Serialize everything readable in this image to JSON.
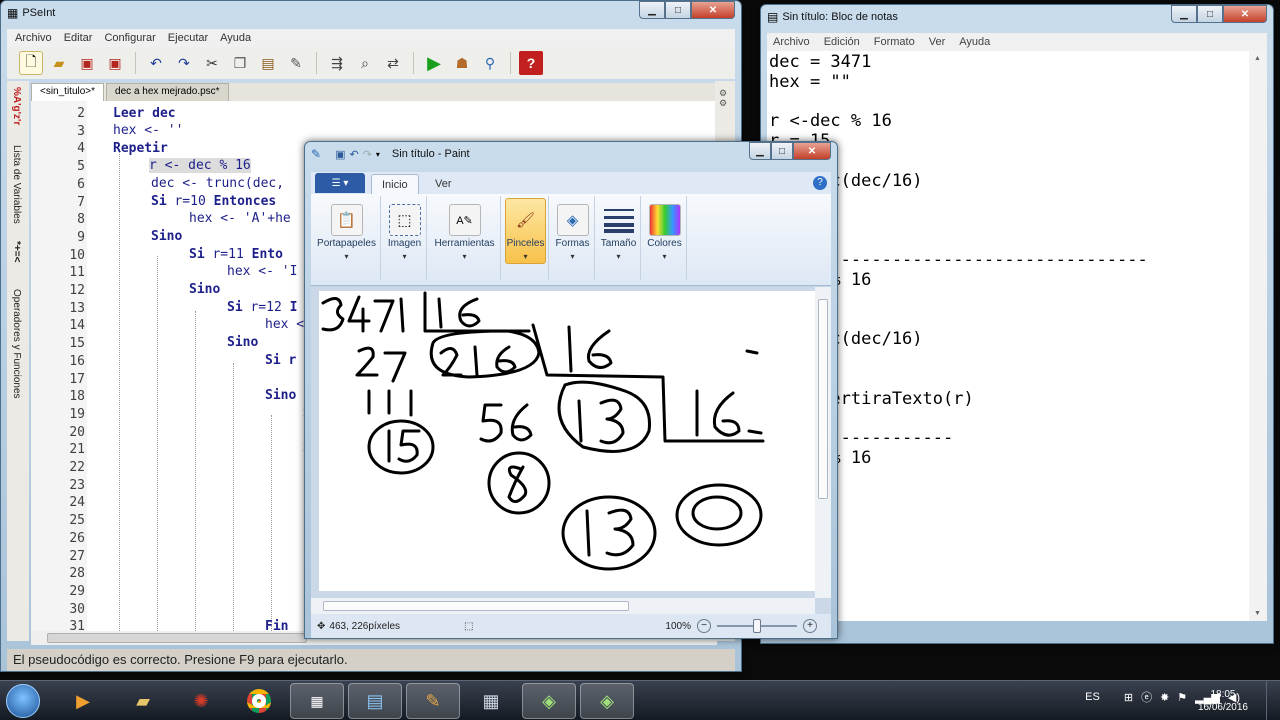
{
  "pseint": {
    "title": "PSeInt",
    "menu": [
      "Archivo",
      "Editar",
      "Configurar",
      "Ejecutar",
      "Ayuda"
    ],
    "tabs": [
      "<sin_titulo>*",
      "dec a hex mejrado.psc*"
    ],
    "sidebar_label_1": "Lista de Variables",
    "sidebar_label_2": "Operadores y Funciones",
    "sidebar_glyphs_1": "%A'g'z'r",
    "sidebar_glyphs_2": "*+=<",
    "line_numbers": [
      "2",
      "3",
      "4",
      "5",
      "6",
      "7",
      "8",
      "9",
      "10",
      "11",
      "12",
      "13",
      "14",
      "15",
      "16",
      "17",
      "18",
      "19",
      "20",
      "21",
      "22",
      "23",
      "24",
      "25",
      "26",
      "27",
      "28",
      "29",
      "30",
      "31"
    ],
    "code": {
      "l2": "Leer dec",
      "l3": "hex <- ''",
      "l4": "Repetir",
      "l5": "r <- dec % 16",
      "l6": "dec <- trunc(dec,",
      "l7a": "Si",
      "l7b": " r=10 ",
      "l7c": "Entonces",
      "l8": "hex <- 'A'+he",
      "l9": "Sino",
      "l10a": "Si",
      "l10b": " r=11 ",
      "l10c": "Ento",
      "l11": "hex <- 'I",
      "l12": "Sino",
      "l13a": "Si",
      "l13b": " r=12 ",
      "l13c": "I",
      "l14": "hex <",
      "l15": "Sino",
      "l16": "Si r",
      "l17": "I",
      "l18": "Sino",
      "l19": "S",
      "l21": "S",
      "l30": "F",
      "l31": "Fin"
    },
    "status": "El pseudocódigo es correcto. Presione F9 para ejecutarlo."
  },
  "notepad": {
    "title": "Sin título: Bloc de notas",
    "menu": [
      "Archivo",
      "Edición",
      "Formato",
      "Ver",
      "Ayuda"
    ],
    "content": "dec = 3471\nhex = \"\"\n\nr <-dec % 16\nr = 15\n\n  trunc(dec/16)\n  216\n\n   F\n-------------------------------------\n  dec % 16\n\n\n  trunc(dec/16)\n  13\n\n  convertiraTexto(r)\n  8F\n------------------\n  dec % 16"
  },
  "paint": {
    "title": "Sin título - Paint",
    "tabs": [
      "Inicio",
      "Ver"
    ],
    "groups": [
      "Portapapeles",
      "Imagen",
      "Herramientas",
      "Pinceles",
      "Formas",
      "Tamaño",
      "Colores"
    ],
    "selected_group": "Pinceles",
    "coords": "463, 226píxeles",
    "zoom": "100%",
    "zoom_level": 0.5
  },
  "taskbar": {
    "language": "ES",
    "time": "18:05",
    "date": "16/06/2016"
  }
}
